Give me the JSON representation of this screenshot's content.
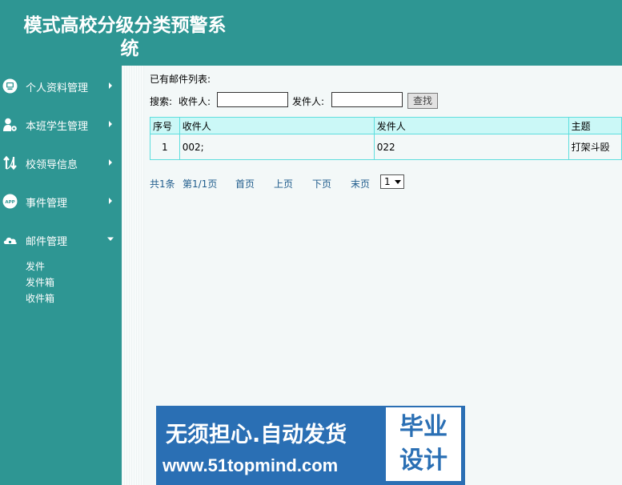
{
  "header": {
    "title_line1": "模式高校分级分类预警系",
    "title_line2": "统"
  },
  "sidebar": {
    "items": [
      {
        "label": "个人资料管理",
        "icon": "monitor-icon"
      },
      {
        "label": "本班学生管理",
        "icon": "user-gear-icon"
      },
      {
        "label": "校领导信息",
        "icon": "transfer-arrows-icon"
      },
      {
        "label": "事件管理",
        "icon": "app-badge-icon"
      },
      {
        "label": "邮件管理",
        "icon": "cloud-icon"
      }
    ],
    "subitems": [
      "发件",
      "发件箱",
      "收件箱"
    ]
  },
  "main": {
    "list_title": "已有邮件列表:",
    "search": {
      "label": "搜索:",
      "recipient_label": "收件人:",
      "recipient_value": "",
      "sender_label": "发件人:",
      "sender_value": "",
      "button": "查找"
    },
    "table": {
      "headers": [
        "序号",
        "收件人",
        "发件人",
        "主题"
      ],
      "rows": [
        [
          "1",
          "002;",
          "022",
          "打架斗殴"
        ]
      ]
    },
    "pager": {
      "total": "共1条",
      "page": "第1/1页",
      "first": "首页",
      "prev": "上页",
      "next": "下页",
      "last": "末页",
      "select_value": "1"
    }
  },
  "watermark": {
    "line1": "无须担心.自动发货",
    "line2": "www.51topmind.com",
    "box_line1": "毕业",
    "box_line2": "设计"
  },
  "colors": {
    "teal": "#2e9693",
    "table_border": "#5fdede",
    "table_header_bg": "#cbf8f7",
    "watermark_blue": "#2a6fb4"
  }
}
